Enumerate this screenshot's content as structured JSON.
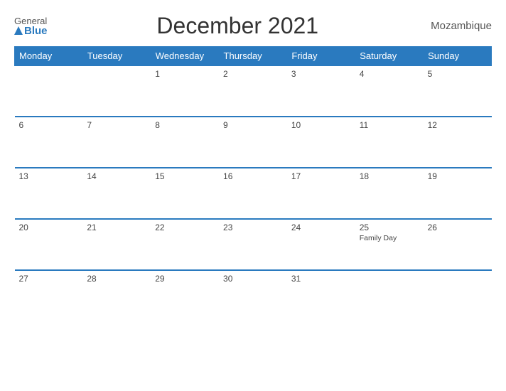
{
  "header": {
    "logo_general": "General",
    "logo_blue": "Blue",
    "title": "December 2021",
    "country": "Mozambique"
  },
  "weekdays": [
    "Monday",
    "Tuesday",
    "Wednesday",
    "Thursday",
    "Friday",
    "Saturday",
    "Sunday"
  ],
  "weeks": [
    [
      {
        "day": "",
        "empty": true
      },
      {
        "day": "",
        "empty": true
      },
      {
        "day": "1"
      },
      {
        "day": "2"
      },
      {
        "day": "3"
      },
      {
        "day": "4"
      },
      {
        "day": "5"
      }
    ],
    [
      {
        "day": "6"
      },
      {
        "day": "7"
      },
      {
        "day": "8"
      },
      {
        "day": "9"
      },
      {
        "day": "10"
      },
      {
        "day": "11"
      },
      {
        "day": "12"
      }
    ],
    [
      {
        "day": "13"
      },
      {
        "day": "14"
      },
      {
        "day": "15"
      },
      {
        "day": "16"
      },
      {
        "day": "17"
      },
      {
        "day": "18"
      },
      {
        "day": "19"
      }
    ],
    [
      {
        "day": "20"
      },
      {
        "day": "21"
      },
      {
        "day": "22"
      },
      {
        "day": "23"
      },
      {
        "day": "24"
      },
      {
        "day": "25",
        "holiday": "Family Day"
      },
      {
        "day": "26"
      }
    ],
    [
      {
        "day": "27"
      },
      {
        "day": "28"
      },
      {
        "day": "29"
      },
      {
        "day": "30"
      },
      {
        "day": "31"
      },
      {
        "day": "",
        "empty": true
      },
      {
        "day": "",
        "empty": true
      }
    ]
  ]
}
